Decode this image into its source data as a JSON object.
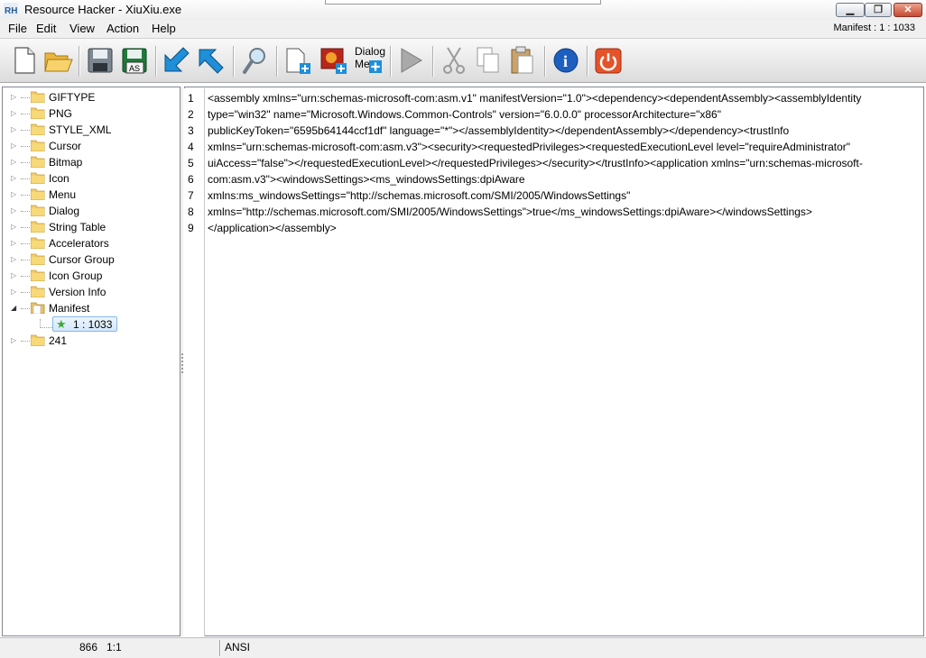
{
  "window": {
    "title": "Resource Hacker - XiuXiu.exe",
    "minimize_glyph": "▁",
    "maximize_glyph": "❐",
    "close_glyph": "✕"
  },
  "menu": {
    "items": [
      "File",
      "Edit",
      "View",
      "Action",
      "Help"
    ],
    "manifest_indicator": "Manifest : 1 : 1033"
  },
  "toolbar": {
    "buttons": [
      {
        "name": "new-icon"
      },
      {
        "name": "open-folder-icon"
      },
      {
        "name": "save-icon"
      },
      {
        "name": "save-as-icon",
        "label": "AS"
      },
      {
        "name": "back-arrow-icon"
      },
      {
        "name": "forward-arrow-icon"
      },
      {
        "name": "find-icon"
      },
      {
        "name": "add-resource-icon"
      },
      {
        "name": "add-image-resource-icon"
      },
      {
        "name": "add-dialog-menu-icon",
        "label_line1": "Dialog",
        "label_line2": "Me"
      },
      {
        "name": "compile-play-icon"
      },
      {
        "name": "cut-icon"
      },
      {
        "name": "copy-icon"
      },
      {
        "name": "paste-icon"
      },
      {
        "name": "info-icon",
        "glyph": "i"
      },
      {
        "name": "exit-power-icon"
      }
    ]
  },
  "tree": {
    "items": [
      "GIFTYPE",
      "PNG",
      "STYLE_XML",
      "Cursor",
      "Bitmap",
      "Icon",
      "Menu",
      "Dialog",
      "String Table",
      "Accelerators",
      "Cursor Group",
      "Icon Group",
      "Version Info",
      "Manifest",
      "241"
    ],
    "expanded_item": "Manifest",
    "child": {
      "label": "1 : 1033",
      "icon": "star-icon"
    },
    "collapsed_arrow": "▷",
    "expanded_arrow": "◢"
  },
  "editor": {
    "line_numbers": [
      "1",
      "2",
      "3",
      "4",
      "5",
      "6",
      "7",
      "8",
      "9"
    ],
    "lines": [
      "<assembly xmlns=\"urn:schemas-microsoft-com:asm.v1\" manifestVersion=\"1.0\"><dependency><dependentAssembly><assemblyIdentity",
      "type=\"win32\" name=\"Microsoft.Windows.Common-Controls\" version=\"6.0.0.0\" processorArchitecture=\"x86\"",
      "publicKeyToken=\"6595b64144ccf1df\" language=\"*\"></assemblyIdentity></dependentAssembly></dependency><trustInfo",
      "xmlns=\"urn:schemas-microsoft-com:asm.v3\"><security><requestedPrivileges><requestedExecutionLevel level=\"requireAdministrator\"",
      "uiAccess=\"false\"></requestedExecutionLevel></requestedPrivileges></security></trustInfo><application xmlns=\"urn:schemas-microsoft-",
      "com:asm.v3\"><windowsSettings><ms_windowsSettings:dpiAware",
      "xmlns:ms_windowsSettings=\"http://schemas.microsoft.com/SMI/2005/WindowsSettings\"",
      "xmlns=\"http://schemas.microsoft.com/SMI/2005/WindowsSettings\">true</ms_windowsSettings:dpiAware></windowsSettings>",
      "</application></assembly>"
    ]
  },
  "status": {
    "char_count": "866",
    "position": "1:1",
    "encoding": "ANSI"
  }
}
